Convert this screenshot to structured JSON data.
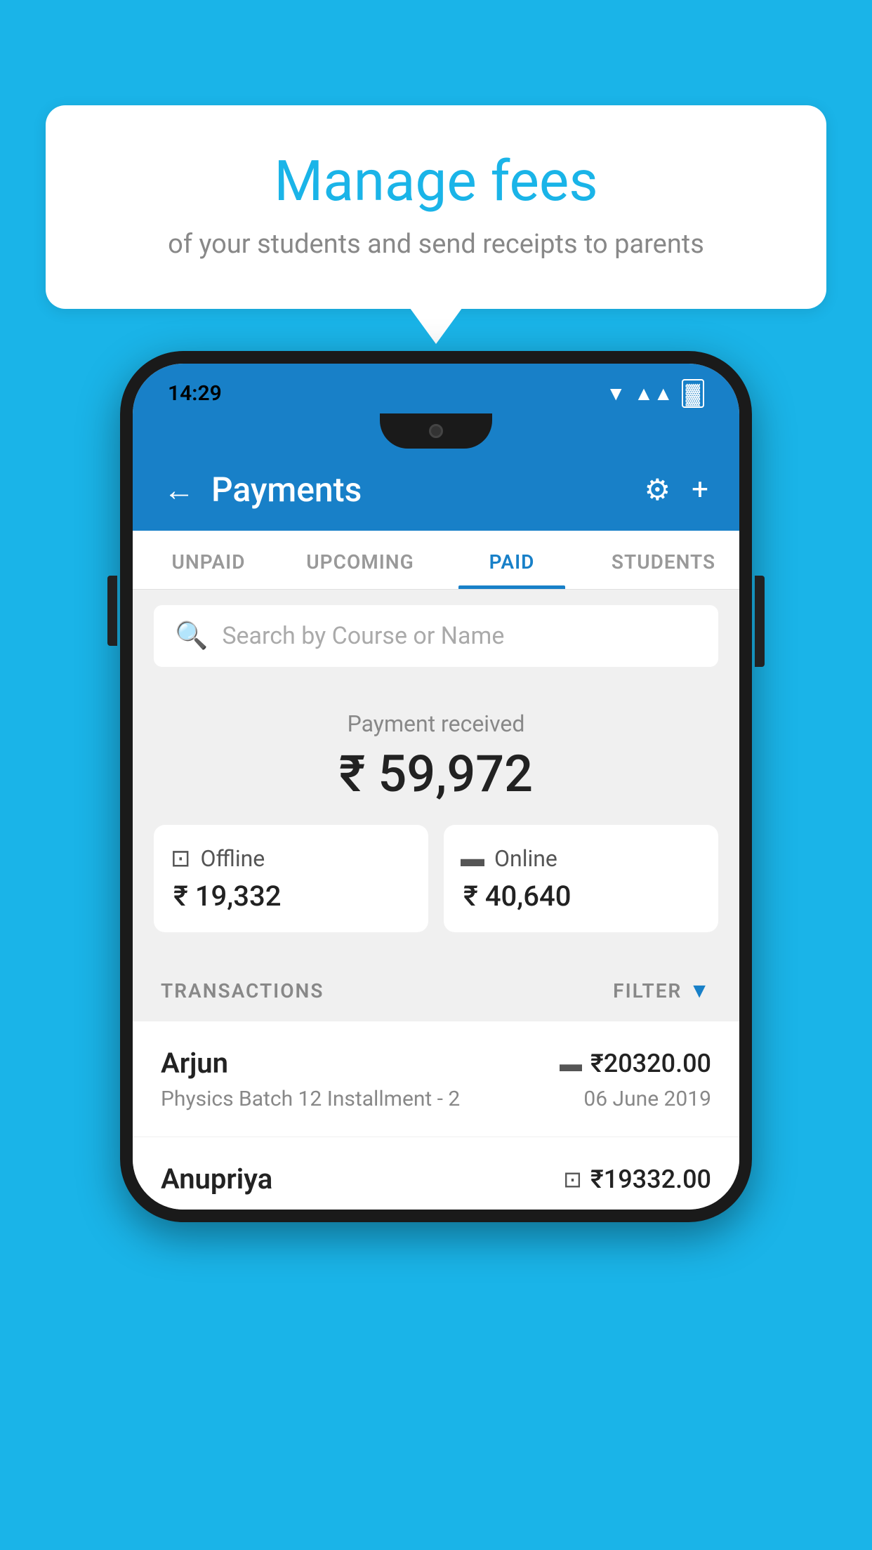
{
  "background_color": "#1ab4e8",
  "bubble": {
    "title": "Manage fees",
    "subtitle": "of your students and send receipts to parents"
  },
  "status_bar": {
    "time": "14:29",
    "wifi": "▼",
    "signal": "▲",
    "battery": "▓"
  },
  "header": {
    "title": "Payments",
    "back_label": "←",
    "gear_label": "⚙",
    "plus_label": "+"
  },
  "tabs": [
    {
      "label": "UNPAID",
      "active": false
    },
    {
      "label": "UPCOMING",
      "active": false
    },
    {
      "label": "PAID",
      "active": true
    },
    {
      "label": "STUDENTS",
      "active": false
    }
  ],
  "search": {
    "placeholder": "Search by Course or Name"
  },
  "payment_summary": {
    "received_label": "Payment received",
    "total_amount": "₹ 59,972",
    "offline_label": "Offline",
    "offline_amount": "₹ 19,332",
    "online_label": "Online",
    "online_amount": "₹ 40,640"
  },
  "transactions": {
    "header_label": "TRANSACTIONS",
    "filter_label": "FILTER",
    "rows": [
      {
        "name": "Arjun",
        "amount": "₹20320.00",
        "course": "Physics Batch 12 Installment - 2",
        "date": "06 June 2019",
        "payment_type": "card"
      },
      {
        "name": "Anupriya",
        "amount": "₹19332.00",
        "course": "",
        "date": "",
        "payment_type": "cash"
      }
    ]
  }
}
